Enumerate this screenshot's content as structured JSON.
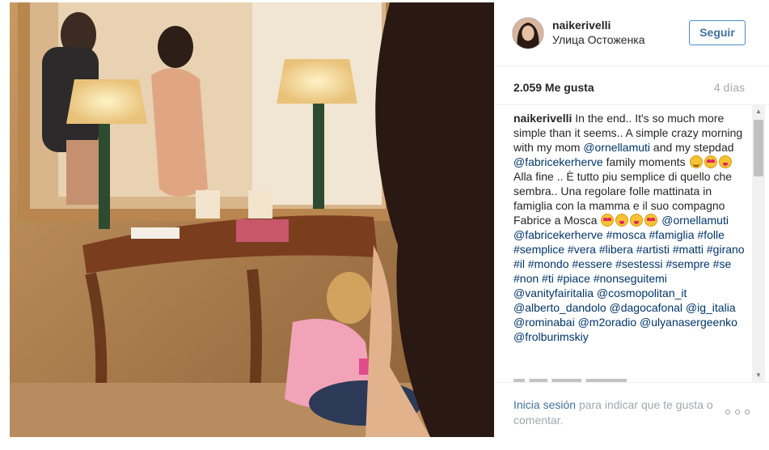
{
  "post": {
    "username": "naikerivelli",
    "location": "Улица Остоженка",
    "follow_label": "Seguir",
    "likes": "2.059 Me gusta",
    "time_ago": "4 días",
    "caption": {
      "user": "naikerivelli",
      "seg1": "In the end.. It's so much more simple than it seems.. A simple crazy morning with my mom",
      "mention1": "@ornellamuti",
      "seg2": "and my stepdad",
      "mention2": "@fabricekerherve",
      "seg3": "family moments",
      "seg4": "Alla fine .. È tutto piu semplice di quello che sembra.. Una regolare folle mattinata in famiglia con la mamma e il suo compagno Fabrice a Mosca",
      "mention3": "@ornellamuti",
      "tags": "@fabricekerherve #mosca #famiglia #folle #semplice #vera #libera #artisti #matti #girano #il #mondo #essere #sestessi #sempre #se #non #ti #piace #nonseguitemi @vanityfairitalia @cosmopolitan_it @alberto_dandolo @dagocafonal @ig_italia @rominabai @m2oradio @ulyanasergeenko @frolburimskiy"
    },
    "emojis_a": [
      "smile",
      "heart",
      "tongue"
    ],
    "emojis_b": [
      "heart",
      "tongue",
      "tongue",
      "heart"
    ]
  },
  "footer": {
    "login_link": "Inicia sesión",
    "login_rest": "para indicar que te gusta o comentar."
  },
  "icons": {
    "more": "more-options-icon",
    "scroll_up": "scroll-up-arrow-icon",
    "scroll_down": "scroll-down-arrow-icon"
  },
  "colors": {
    "link": "#003569",
    "follow": "#3f729b",
    "muted": "#a5a7aa"
  }
}
